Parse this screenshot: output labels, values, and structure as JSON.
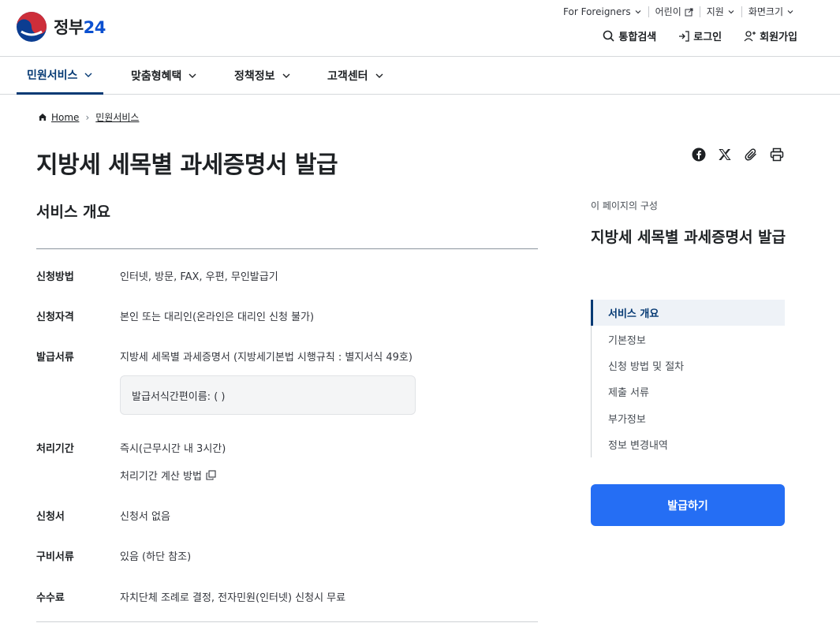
{
  "header": {
    "logo_text": "정부",
    "logo_num": "24",
    "util_links": [
      {
        "label": "For Foreigners",
        "icon": "chevron-down-icon"
      },
      {
        "label": "어린이",
        "icon": "external-link-icon"
      },
      {
        "label": "지원",
        "icon": "chevron-down-icon"
      },
      {
        "label": "화면크기",
        "icon": "chevron-down-icon"
      }
    ],
    "main_links": [
      {
        "label": "통합검색",
        "icon": "search-icon"
      },
      {
        "label": "로그인",
        "icon": "login-icon"
      },
      {
        "label": "회원가입",
        "icon": "user-add-icon"
      }
    ]
  },
  "nav": {
    "tabs": [
      {
        "label": "민원서비스"
      },
      {
        "label": "맞춤형혜택"
      },
      {
        "label": "정책정보"
      },
      {
        "label": "고객센터"
      }
    ]
  },
  "breadcrumb": {
    "home": "Home",
    "current": "민원서비스"
  },
  "page": {
    "title": "지방세 세목별 과세증명서 발급",
    "section_title": "서비스 개요"
  },
  "share": [
    "facebook-icon",
    "x-icon",
    "link-icon",
    "print-icon"
  ],
  "info": {
    "rows": [
      {
        "label": "신청방법",
        "value": "인터넷, 방문, FAX, 우편, 무인발급기"
      },
      {
        "label": "신청자격",
        "value": "본인 또는 대리인(온라인은 대리인 신청 불가)"
      },
      {
        "label": "발급서류",
        "value": "지방세 세목별 과세증명서 (지방세기본법 시행규칙 : 별지서식 49호)"
      },
      {
        "label": "처리기간",
        "value": "즉시(근무시간 내 3시간)"
      },
      {
        "label": "신청서",
        "value": "신청서 없음"
      },
      {
        "label": "구비서류",
        "value": "있음 (하단 참조)"
      },
      {
        "label": "수수료",
        "value": "자치단체 조례로 결정, 전자민원(인터넷) 신청시 무료"
      }
    ],
    "note": "발급서식간편이름: ( )",
    "process_link": "처리기간 계산 방법"
  },
  "toc": {
    "caption": "이 페이지의 구성",
    "title": "지방세 세목별 과세증명서 발급",
    "items": [
      "서비스 개요",
      "기본정보",
      "신청 방법 및 절차",
      "제출 서류",
      "부가정보",
      "정보 변경내역"
    ]
  },
  "apply_button": "발급하기",
  "colors": {
    "primary": "#256ef4",
    "active_nav": "#063a74"
  }
}
